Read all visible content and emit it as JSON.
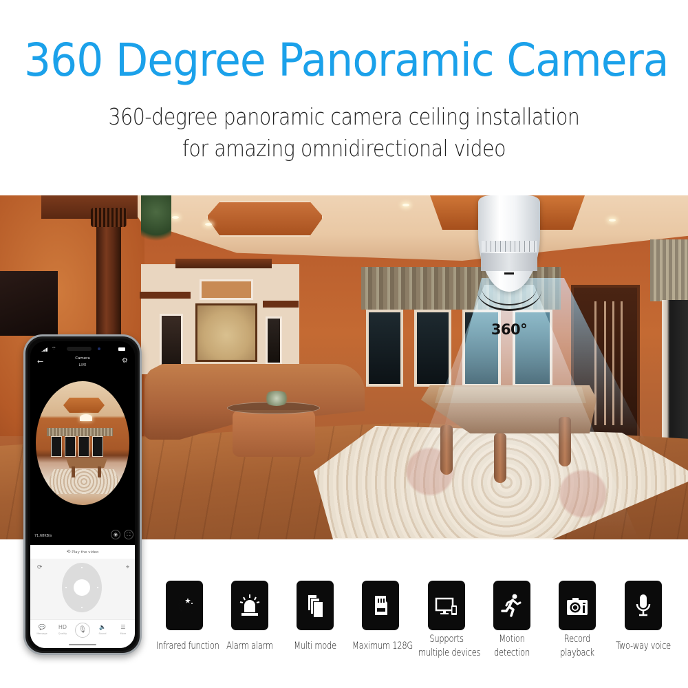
{
  "header": {
    "title": "360 Degree Panoramic Camera",
    "subtitle_line1": "360-degree panoramic camera ceiling installation",
    "subtitle_line2": "for amazing omnidirectional video"
  },
  "photo": {
    "rotation_label": "360°",
    "beam_color": "#7ec8ea"
  },
  "phone_app": {
    "screen_title": "Camera",
    "screen_status": "LIVE",
    "icons": {
      "back": "←",
      "settings": "⚙",
      "wifi": "⌔",
      "snapshot": "◉",
      "fullscreen": "⛶",
      "replay": "⟲",
      "rotate": "⟳",
      "target": "⌖",
      "mic": "🎙"
    },
    "data_rate": "71.68KB/s",
    "play_video_label": "Play the video",
    "bottom_nav": [
      {
        "icon": "💬",
        "label": "Message"
      },
      {
        "icon": "HD",
        "label": "Quality"
      },
      {
        "icon": "🔈",
        "label": "Sound"
      },
      {
        "icon": "☰",
        "label": "More"
      }
    ]
  },
  "features": [
    {
      "icon": "moon-stars-icon",
      "label_line1": "Infrared function",
      "label_line2": ""
    },
    {
      "icon": "alarm-siren-icon",
      "label_line1": "Alarm alarm",
      "label_line2": ""
    },
    {
      "icon": "multi-pages-icon",
      "label_line1": "Multi mode",
      "label_line2": ""
    },
    {
      "icon": "sd-card-icon",
      "label_line1": "Maximum 128G",
      "label_line2": ""
    },
    {
      "icon": "monitor-phone-icon",
      "label_line1": "Supports",
      "label_line2": "multiple devices"
    },
    {
      "icon": "running-person-icon",
      "label_line1": "Motion",
      "label_line2": "detection"
    },
    {
      "icon": "camera-icon",
      "label_line1": "Record",
      "label_line2": "playback"
    },
    {
      "icon": "microphone-icon",
      "label_line1": "Two-way voice",
      "label_line2": ""
    }
  ],
  "colors": {
    "title": "#1ba1ea",
    "subtitle": "#1f1f1f",
    "feature_tile": "#0b0b0b"
  }
}
